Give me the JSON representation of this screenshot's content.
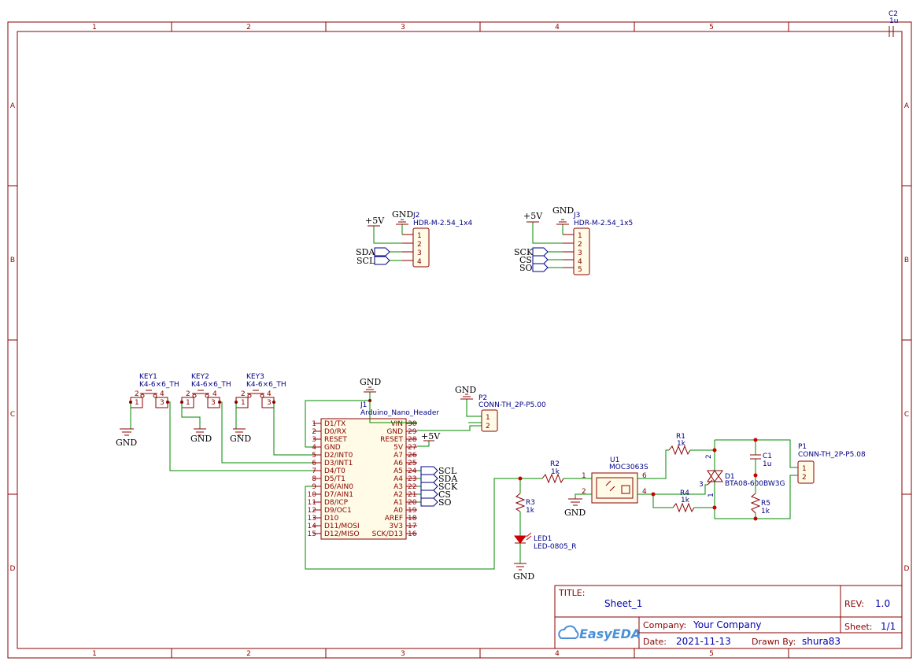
{
  "frame": {
    "columns": [
      "1",
      "2",
      "3",
      "4",
      "5"
    ],
    "rows": [
      "A",
      "B",
      "C",
      "D"
    ]
  },
  "title_block": {
    "title_label": "TITLE:",
    "title": "Sheet_1",
    "rev_label": "REV:",
    "rev": "1.0",
    "company_label": "Company:",
    "company": "Your Company",
    "sheet_label": "Sheet:",
    "sheet": "1/1",
    "date_label": "Date:",
    "date": "2021-11-13",
    "drawn_label": "Drawn By:",
    "drawn_by": "shura83",
    "logo_text": "EasyEDA"
  },
  "components": {
    "c2": {
      "ref": "C2",
      "value": "1u"
    },
    "j2": {
      "ref": "J2",
      "value": "HDR-M-2.54_1x4",
      "pins": [
        "1",
        "2",
        "3",
        "4"
      ]
    },
    "j3": {
      "ref": "J3",
      "value": "HDR-M-2.54_1x5",
      "pins": [
        "1",
        "2",
        "3",
        "4",
        "5"
      ]
    },
    "key1": {
      "ref": "KEY1",
      "value": "K4-6×6_TH"
    },
    "key2": {
      "ref": "KEY2",
      "value": "K4-6×6_TH"
    },
    "key3": {
      "ref": "KEY3",
      "value": "K4-6×6_TH"
    },
    "key_pins": {
      "p1": "1",
      "p2": "2",
      "p3": "3",
      "p4": "4"
    },
    "j1": {
      "ref": "J1",
      "value": "Arduino_Nano_Header",
      "left_pins": [
        {
          "num": "1",
          "name": "D1/TX"
        },
        {
          "num": "2",
          "name": "D0/RX"
        },
        {
          "num": "3",
          "name": "RESET"
        },
        {
          "num": "4",
          "name": "GND"
        },
        {
          "num": "5",
          "name": "D2/INT0"
        },
        {
          "num": "6",
          "name": "D3/INT1"
        },
        {
          "num": "7",
          "name": "D4/T0"
        },
        {
          "num": "8",
          "name": "D5/T1"
        },
        {
          "num": "9",
          "name": "D6/AIN0"
        },
        {
          "num": "10",
          "name": "D7/AIN1"
        },
        {
          "num": "11",
          "name": "D8/ICP"
        },
        {
          "num": "12",
          "name": "D9/OC1"
        },
        {
          "num": "13",
          "name": "D10"
        },
        {
          "num": "14",
          "name": "D11/MOSI"
        },
        {
          "num": "15",
          "name": "D12/MISO"
        }
      ],
      "right_pins": [
        {
          "num": "30",
          "name": "VIN"
        },
        {
          "num": "29",
          "name": "GND"
        },
        {
          "num": "28",
          "name": "RESET"
        },
        {
          "num": "27",
          "name": "5V"
        },
        {
          "num": "26",
          "name": "A7"
        },
        {
          "num": "25",
          "name": "A6"
        },
        {
          "num": "24",
          "name": "A5"
        },
        {
          "num": "23",
          "name": "A4"
        },
        {
          "num": "22",
          "name": "A3"
        },
        {
          "num": "21",
          "name": "A2"
        },
        {
          "num": "20",
          "name": "A1"
        },
        {
          "num": "19",
          "name": "A0"
        },
        {
          "num": "18",
          "name": "AREF"
        },
        {
          "num": "17",
          "name": "3V3"
        },
        {
          "num": "16",
          "name": "SCK/D13"
        }
      ]
    },
    "p2": {
      "ref": "P2",
      "value": "CONN-TH_2P-P5.00",
      "pins": [
        "1",
        "2"
      ]
    },
    "p1": {
      "ref": "P1",
      "value": "CONN-TH_2P-P5.08",
      "pins": [
        "1",
        "2"
      ]
    },
    "r1": {
      "ref": "R1",
      "value": "1k"
    },
    "r2": {
      "ref": "R2",
      "value": "1k"
    },
    "r3": {
      "ref": "R3",
      "value": "1k"
    },
    "r4": {
      "ref": "R4",
      "value": "1k"
    },
    "r5": {
      "ref": "R5",
      "value": "1k"
    },
    "c1": {
      "ref": "C1",
      "value": "1u"
    },
    "u1": {
      "ref": "U1",
      "value": "MOC3063S",
      "pins": [
        "1",
        "2",
        "4",
        "6"
      ]
    },
    "d1": {
      "ref": "D1",
      "value": "BTA08-600BW3G",
      "pins": [
        "1",
        "2",
        "3"
      ]
    },
    "led1": {
      "ref": "LED1",
      "value": "LED-0805_R"
    }
  },
  "net_labels": {
    "gnd": "GND",
    "vcc": "+5V",
    "sda": "SDA",
    "scl": "SCL",
    "sck": "SCK",
    "cs": "CS",
    "so": "SO"
  }
}
